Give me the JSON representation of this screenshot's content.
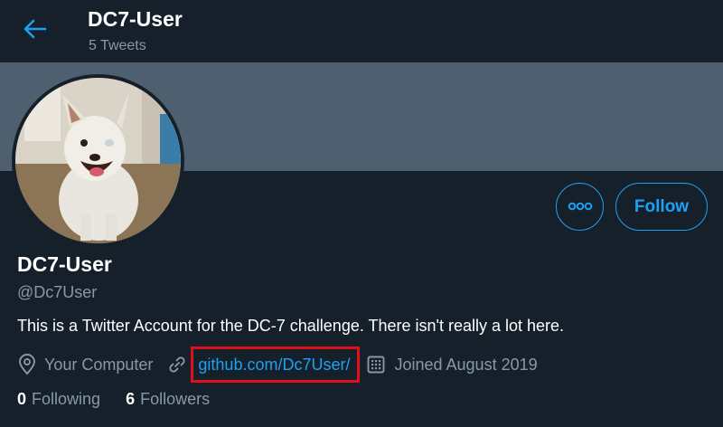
{
  "header": {
    "title": "DC7-User",
    "tweet_count": "5 Tweets"
  },
  "profile": {
    "display_name": "DC7-User",
    "handle": "@Dc7User",
    "bio": "This is a Twitter Account for the DC-7 challenge. There isn't really a lot here.",
    "location": "Your Computer",
    "url": "github.com/Dc7User/",
    "joined": "Joined August 2019",
    "following_count": "0",
    "following_label": "Following",
    "followers_count": "6",
    "followers_label": "Followers"
  },
  "actions": {
    "follow_label": "Follow",
    "more_icon": "more-icon"
  },
  "colors": {
    "background": "#15202b",
    "banner": "#4e5f70",
    "accent": "#1da1f2",
    "secondary_text": "#8899a6",
    "highlight_box": "#e0101a"
  }
}
